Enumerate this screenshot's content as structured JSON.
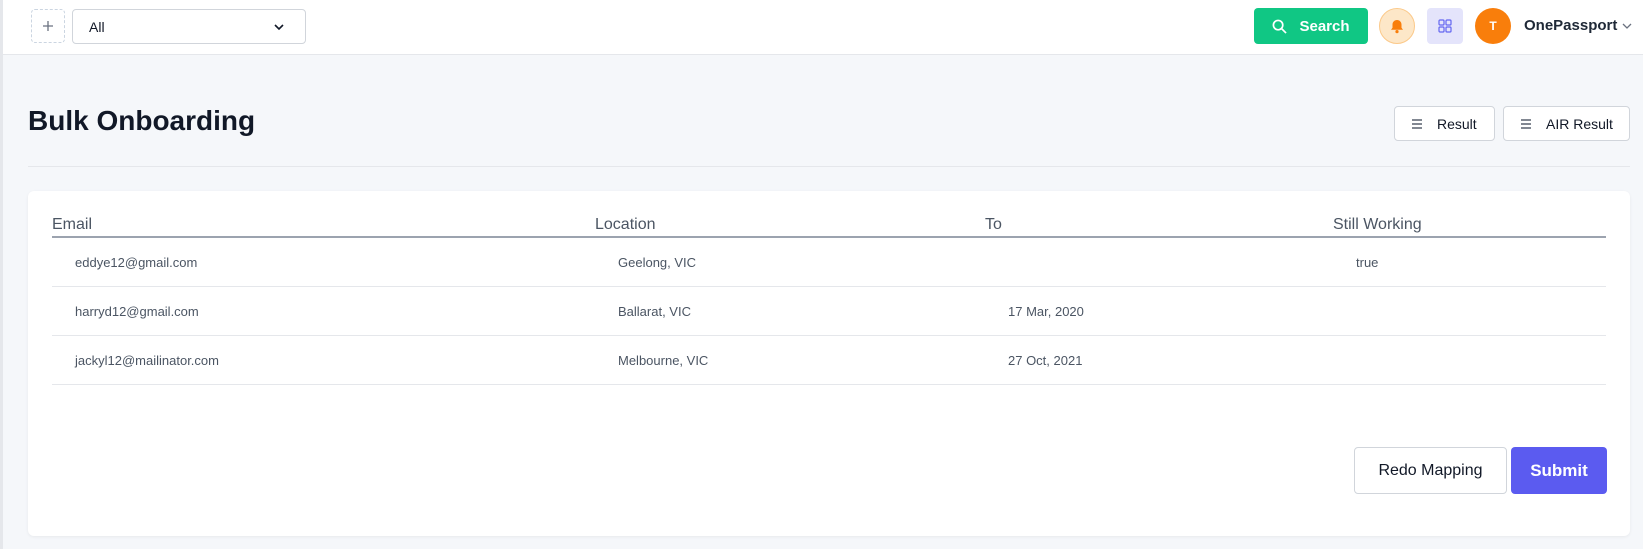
{
  "topbar": {
    "add_icon": "plus-icon",
    "filter_select": {
      "value": "All",
      "icon": "chevron-down-icon"
    },
    "search_button": {
      "label": "Search",
      "icon": "search-icon",
      "color": "#10c784"
    },
    "notification_icon": "bell-icon",
    "apps_icon": "grid-icon",
    "user": {
      "initial": "T",
      "name": "OnePassport",
      "avatar_color": "#f97e0b"
    }
  },
  "page": {
    "title": "Bulk Onboarding",
    "buttons": [
      {
        "label": "Result",
        "icon": "list-icon"
      },
      {
        "label": "AIR Result",
        "icon": "list-icon"
      }
    ]
  },
  "table": {
    "columns": [
      "Email",
      "Location",
      "To",
      "Still Working"
    ],
    "rows": [
      {
        "email": "eddye12@gmail.com",
        "location": "Geelong, VIC",
        "to": "",
        "still_working": "true"
      },
      {
        "email": "harryd12@gmail.com",
        "location": "Ballarat, VIC",
        "to": "17 Mar, 2020",
        "still_working": ""
      },
      {
        "email": "jackyl12@mailinator.com",
        "location": "Melbourne, VIC",
        "to": "27 Oct, 2021",
        "still_working": ""
      }
    ]
  },
  "actions": {
    "redo_label": "Redo Mapping",
    "submit_label": "Submit",
    "submit_color": "#5b5bf0"
  }
}
